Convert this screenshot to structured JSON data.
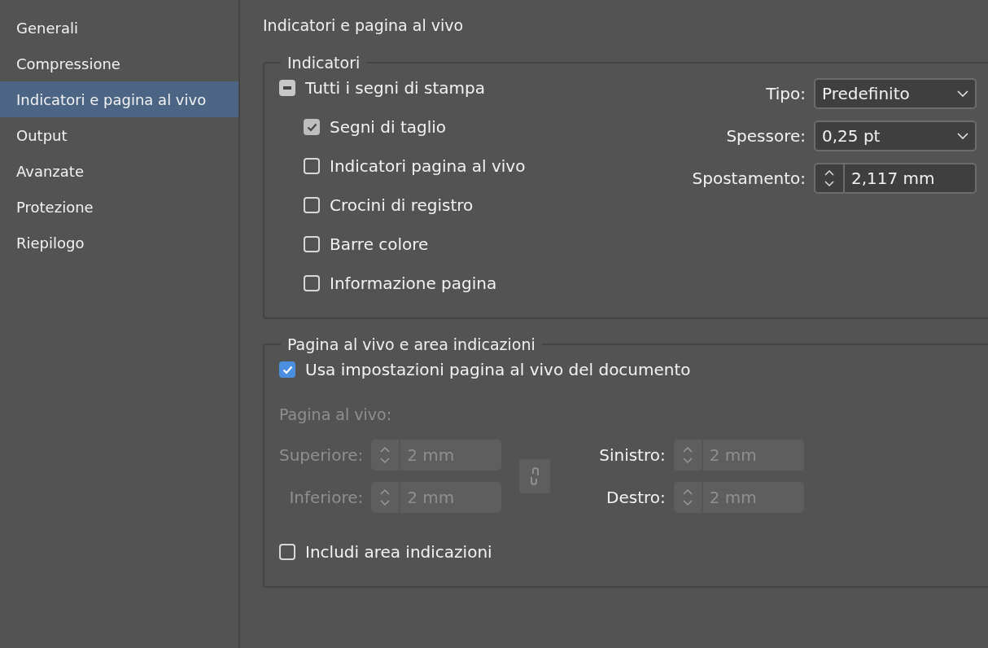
{
  "sidebar": {
    "items": [
      {
        "label": "Generali",
        "selected": false
      },
      {
        "label": "Compressione",
        "selected": false
      },
      {
        "label": "Indicatori e pagina al vivo",
        "selected": true
      },
      {
        "label": "Output",
        "selected": false
      },
      {
        "label": "Avanzate",
        "selected": false
      },
      {
        "label": "Protezione",
        "selected": false
      },
      {
        "label": "Riepilogo",
        "selected": false
      }
    ]
  },
  "panel": {
    "title": "Indicatori e pagina al vivo",
    "marks_group": {
      "legend": "Indicatori",
      "all_marks": {
        "label": "Tutti i segni di stampa",
        "indeterminate": true
      },
      "options": [
        {
          "label": "Segni di taglio",
          "checked": true,
          "disabled": true
        },
        {
          "label": "Indicatori pagina al vivo",
          "checked": false,
          "disabled": false
        },
        {
          "label": "Crocini di registro",
          "checked": false,
          "disabled": false
        },
        {
          "label": "Barre colore",
          "checked": false,
          "disabled": false
        },
        {
          "label": "Informazione pagina",
          "checked": false,
          "disabled": false
        }
      ],
      "settings": [
        {
          "kind": "dropdown",
          "label": "Tipo:",
          "value": "Predefinito"
        },
        {
          "kind": "dropdown",
          "label": "Spessore:",
          "value": "0,25 pt"
        },
        {
          "kind": "spinner",
          "label": "Spostamento:",
          "value": "2,117 mm"
        }
      ]
    },
    "bleed_group": {
      "legend": "Pagina al vivo e area indicazioni",
      "use_document": {
        "label": "Usa impostazioni pagina al vivo del documento",
        "checked": true
      },
      "subheading": "Pagina al vivo:",
      "left_fields": [
        {
          "label": "Superiore:",
          "value": "2 mm",
          "label_disabled": true
        },
        {
          "label": "Inferiore:",
          "value": "2 mm",
          "label_disabled": true
        }
      ],
      "link": {
        "disabled": true
      },
      "right_fields": [
        {
          "label": "Sinistro:",
          "value": "2 mm",
          "label_disabled": false
        },
        {
          "label": "Destro:",
          "value": "2 mm",
          "label_disabled": false
        }
      ],
      "fields_disabled": true,
      "include_slug": {
        "label": "Includi area indicazioni",
        "checked": false
      }
    }
  }
}
